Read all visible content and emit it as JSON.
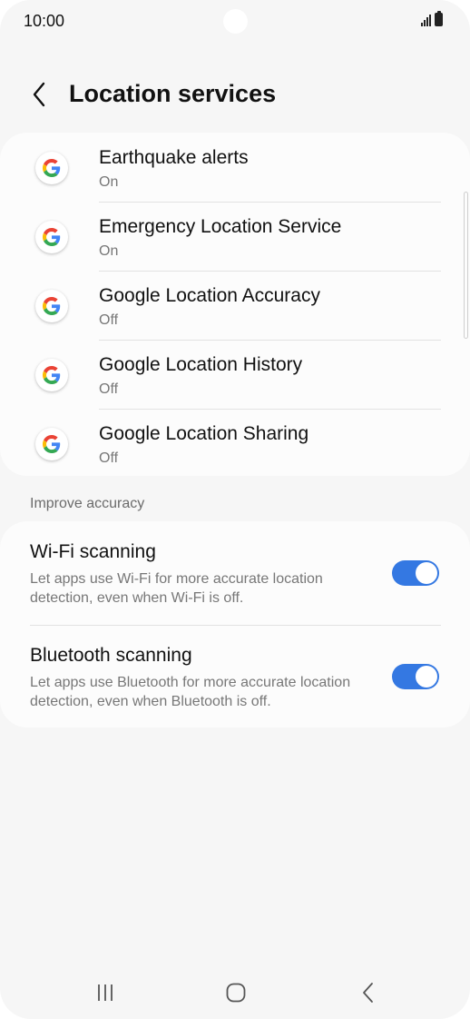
{
  "status_bar": {
    "time": "10:00"
  },
  "header": {
    "title": "Location services",
    "back_icon": "chevron-left-icon"
  },
  "services": [
    {
      "title": "Earthquake alerts",
      "status": "On",
      "icon": "google-g-icon"
    },
    {
      "title": "Emergency Location Service",
      "status": "On",
      "icon": "google-g-icon"
    },
    {
      "title": "Google Location Accuracy",
      "status": "Off",
      "icon": "google-g-icon"
    },
    {
      "title": "Google Location History",
      "status": "Off",
      "icon": "google-g-icon"
    },
    {
      "title": "Google Location Sharing",
      "status": "Off",
      "icon": "google-g-icon"
    }
  ],
  "improve_accuracy": {
    "header": "Improve accuracy",
    "items": [
      {
        "title": "Wi-Fi scanning",
        "description": "Let apps use Wi-Fi for more accurate location detection, even when Wi-Fi is off.",
        "enabled": true
      },
      {
        "title": "Bluetooth scanning",
        "description": "Let apps use Bluetooth for more accurate location detection, even when Bluetooth is off.",
        "enabled": true
      }
    ]
  },
  "nav_bar": {
    "recents_icon": "recents-icon",
    "home_icon": "home-icon",
    "back_icon": "back-icon"
  },
  "colors": {
    "accent": "#3478e2",
    "background": "#f6f6f6",
    "card": "#fcfcfc",
    "secondary_text": "#777777"
  }
}
